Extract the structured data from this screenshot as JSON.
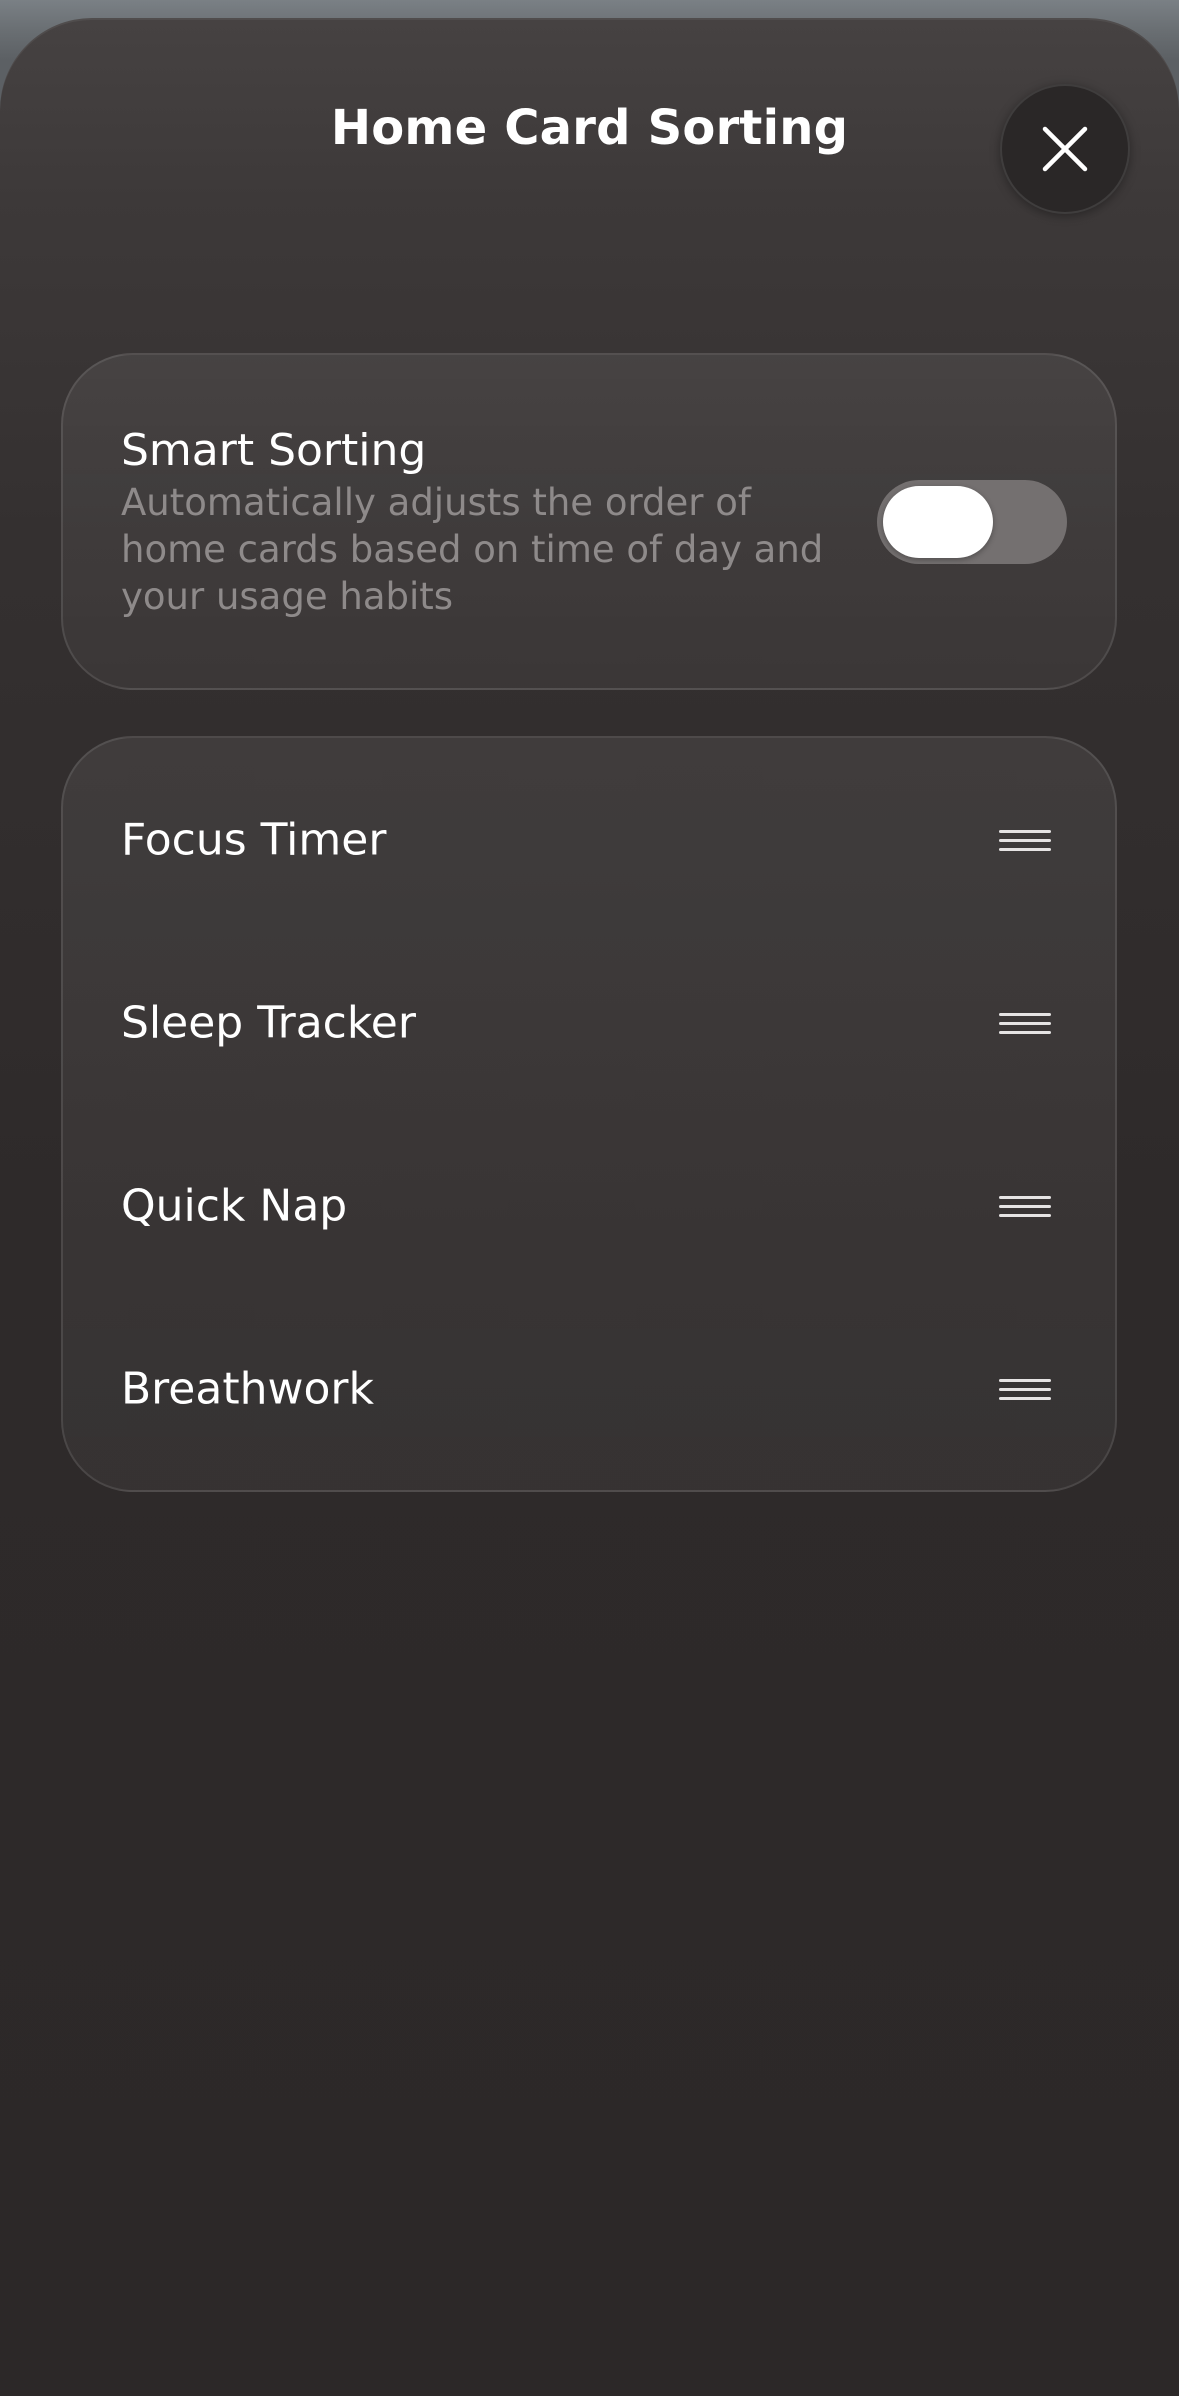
{
  "header": {
    "title": "Home Card Sorting",
    "close_icon": "close-icon"
  },
  "smart_sorting": {
    "title": "Smart Sorting",
    "description": "Automatically adjusts the order of home cards based on time of day and your usage habits",
    "enabled": false
  },
  "cards": {
    "items": [
      {
        "label": "Focus Timer",
        "handle_icon": "drag-handle-icon"
      },
      {
        "label": "Sleep Tracker",
        "handle_icon": "drag-handle-icon"
      },
      {
        "label": "Quick Nap",
        "handle_icon": "drag-handle-icon"
      },
      {
        "label": "Breathwork",
        "handle_icon": "drag-handle-icon"
      }
    ]
  },
  "colors": {
    "sheet_background": "#2e2a2a",
    "card_background": "#3f3b3b",
    "toggle_track": "#747070",
    "text_primary": "#ffffff",
    "text_secondary": "#8e8a8a"
  }
}
